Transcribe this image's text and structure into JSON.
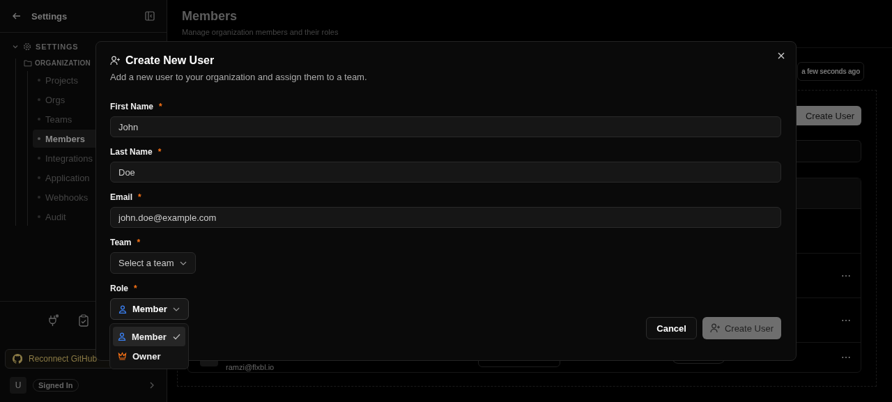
{
  "sidebar": {
    "title": "Settings",
    "tree": {
      "label": "SETTINGS",
      "expanded": true,
      "children": [
        {
          "label": "ORGANIZATION",
          "expanded": true,
          "children": [
            {
              "label": "Projects",
              "selected": false
            },
            {
              "label": "Orgs",
              "selected": false
            },
            {
              "label": "Teams",
              "selected": false
            },
            {
              "label": "Members",
              "selected": true
            },
            {
              "label": "Integrations",
              "selected": false
            },
            {
              "label": "Application",
              "selected": false
            },
            {
              "label": "Webhooks",
              "selected": false
            },
            {
              "label": "Audit",
              "selected": false
            }
          ]
        }
      ]
    },
    "github_button": "Reconnect GitHub",
    "user": {
      "avatar": "U",
      "status": "Signed In"
    }
  },
  "page": {
    "title": "Members",
    "subtitle": "Manage organization members and their roles",
    "updated": "a few seconds ago",
    "create_button": "Create User",
    "row_menus": [
      "⋯",
      "⋯",
      "⋯"
    ],
    "last_row": {
      "email": "ramzi@flxbl.io"
    }
  },
  "dialog": {
    "title": "Create New User",
    "description": "Add a new user to your organization and assign them to a team.",
    "fields": [
      {
        "label": "First Name",
        "required_mark": "*",
        "value": "John"
      },
      {
        "label": "Last Name",
        "required_mark": "*",
        "value": "Doe"
      },
      {
        "label": "Email",
        "required_mark": "*",
        "value": "john.doe@example.com"
      }
    ],
    "team": {
      "label": "Team",
      "required_mark": "*",
      "placeholder": "Select a team"
    },
    "role": {
      "label": "Role",
      "required_mark": "*",
      "value": "Member",
      "open": true,
      "options": [
        {
          "kind": "member",
          "label": "Member",
          "selected": true
        },
        {
          "kind": "owner",
          "label": "Owner",
          "selected": false
        }
      ]
    },
    "cancel_button": "Cancel",
    "submit_button": {
      "label": "Create User",
      "disabled": true
    }
  }
}
